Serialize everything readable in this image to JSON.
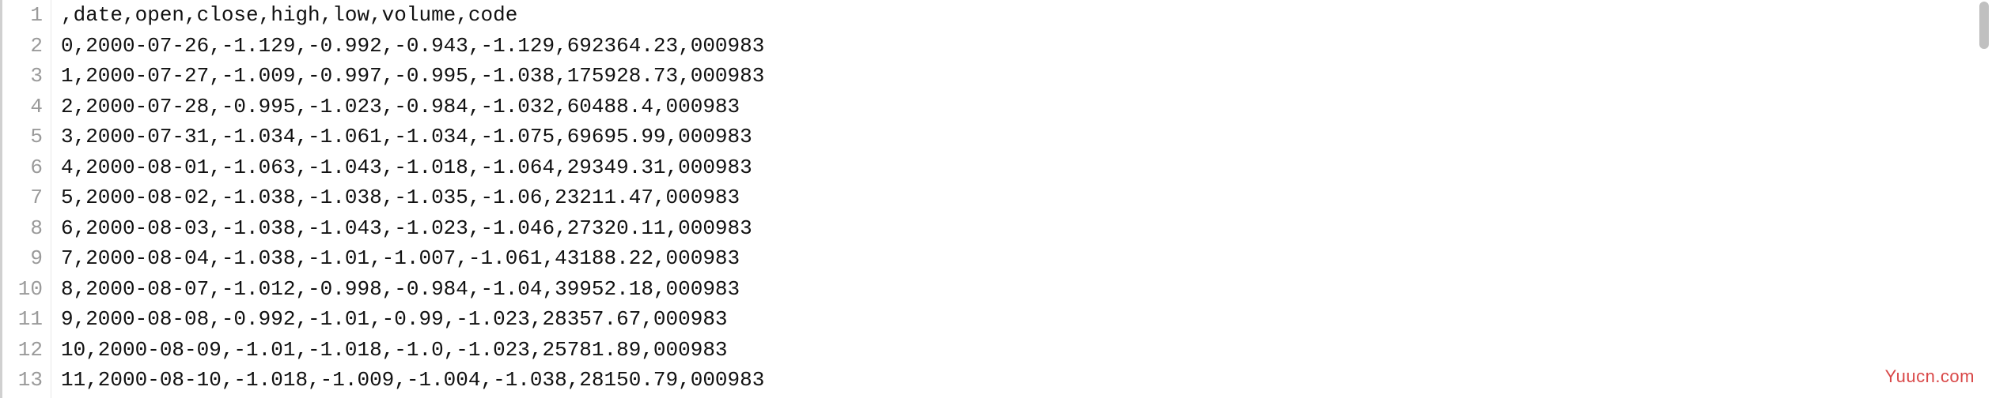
{
  "watermark": "Yuucn.com",
  "header": ",date,open,close,high,low,volume,code",
  "rows": [
    {
      "idx": "0",
      "date": "2000-07-26",
      "open": "-1.129",
      "close": "-0.992",
      "high": "-0.943",
      "low": "-1.129",
      "volume": "692364.23",
      "code": "000983"
    },
    {
      "idx": "1",
      "date": "2000-07-27",
      "open": "-1.009",
      "close": "-0.997",
      "high": "-0.995",
      "low": "-1.038",
      "volume": "175928.73",
      "code": "000983"
    },
    {
      "idx": "2",
      "date": "2000-07-28",
      "open": "-0.995",
      "close": "-1.023",
      "high": "-0.984",
      "low": "-1.032",
      "volume": "60488.4",
      "code": "000983"
    },
    {
      "idx": "3",
      "date": "2000-07-31",
      "open": "-1.034",
      "close": "-1.061",
      "high": "-1.034",
      "low": "-1.075",
      "volume": "69695.99",
      "code": "000983"
    },
    {
      "idx": "4",
      "date": "2000-08-01",
      "open": "-1.063",
      "close": "-1.043",
      "high": "-1.018",
      "low": "-1.064",
      "volume": "29349.31",
      "code": "000983"
    },
    {
      "idx": "5",
      "date": "2000-08-02",
      "open": "-1.038",
      "close": "-1.038",
      "high": "-1.035",
      "low": "-1.06",
      "volume": "23211.47",
      "code": "000983"
    },
    {
      "idx": "6",
      "date": "2000-08-03",
      "open": "-1.038",
      "close": "-1.043",
      "high": "-1.023",
      "low": "-1.046",
      "volume": "27320.11",
      "code": "000983"
    },
    {
      "idx": "7",
      "date": "2000-08-04",
      "open": "-1.038",
      "close": "-1.01",
      "high": "-1.007",
      "low": "-1.061",
      "volume": "43188.22",
      "code": "000983"
    },
    {
      "idx": "8",
      "date": "2000-08-07",
      "open": "-1.012",
      "close": "-0.998",
      "high": "-0.984",
      "low": "-1.04",
      "volume": "39952.18",
      "code": "000983"
    },
    {
      "idx": "9",
      "date": "2000-08-08",
      "open": "-0.992",
      "close": "-1.01",
      "high": "-0.99",
      "low": "-1.023",
      "volume": "28357.67",
      "code": "000983"
    },
    {
      "idx": "10",
      "date": "2000-08-09",
      "open": "-1.01",
      "close": "-1.018",
      "high": "-1.0",
      "low": "-1.023",
      "volume": "25781.89",
      "code": "000983"
    },
    {
      "idx": "11",
      "date": "2000-08-10",
      "open": "-1.018",
      "close": "-1.009",
      "high": "-1.004",
      "low": "-1.038",
      "volume": "28150.79",
      "code": "000983"
    }
  ],
  "line_numbers": [
    "1",
    "2",
    "3",
    "4",
    "5",
    "6",
    "7",
    "8",
    "9",
    "10",
    "11",
    "12",
    "13"
  ]
}
